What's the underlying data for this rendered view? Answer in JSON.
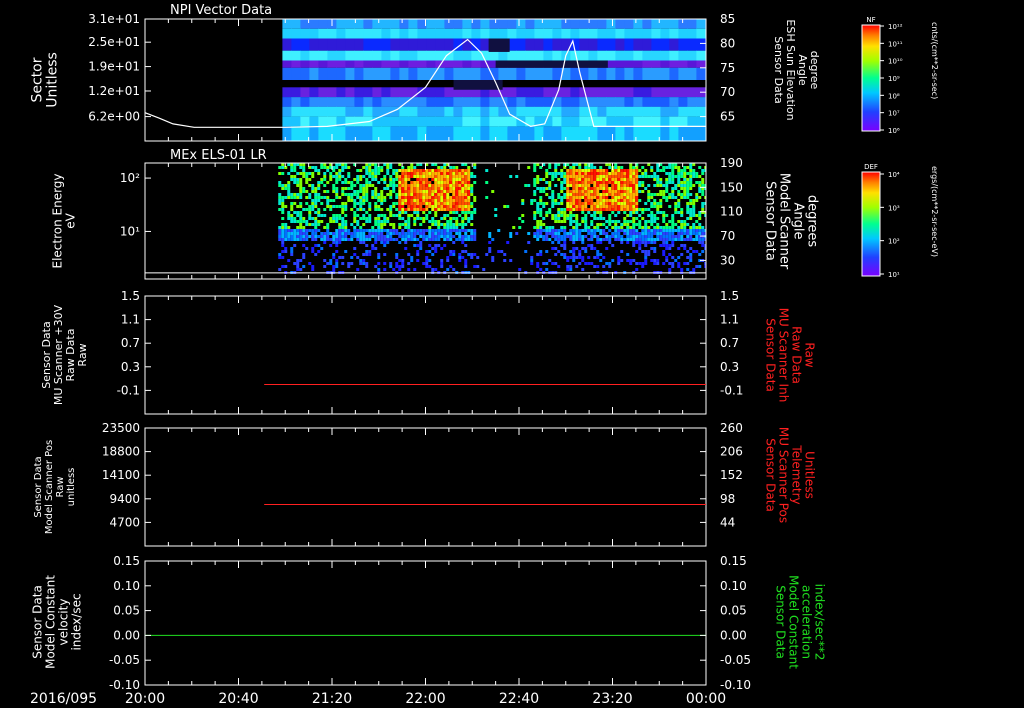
{
  "colors": {
    "background": "#000000",
    "axis": "#ffffff",
    "red_trace": "#ff2020",
    "green_trace": "#20e020",
    "white_trace": "#ffffff"
  },
  "time_axis": {
    "date_label": "2016/095",
    "ticks": [
      "20:00",
      "20:40",
      "21:20",
      "22:00",
      "22:40",
      "23:20",
      "00:00"
    ],
    "range_hours": [
      20.0,
      24.0
    ]
  },
  "chart_data": [
    {
      "type": "heatmap",
      "title": "NPI Vector Data",
      "ylabel_left": [
        "Sector",
        "Unitless"
      ],
      "yticks_left": [
        "3.1e+01",
        "2.5e+01",
        "1.9e+01",
        "1.2e+01",
        "6.2e+00"
      ],
      "ylabel_right": [
        "Sensor Data",
        "ESH Sun Elevation",
        "Angle",
        "degree"
      ],
      "yticks_right": [
        "85",
        "80",
        "75",
        "70",
        "65"
      ],
      "ylim_right": [
        60,
        85
      ],
      "colorbar": {
        "label": "NF",
        "units": "cnts/(cm**2-sr-sec)",
        "ticks": [
          "10¹²",
          "10¹¹",
          "10¹⁰",
          "10⁹",
          "10⁸",
          "10⁷",
          "10⁶"
        ]
      },
      "data_start_hour": 20.98,
      "overlay_line": {
        "name": "ESH Sun Elevation Angle",
        "x": [
          20.0,
          20.1,
          20.2,
          20.35,
          20.6,
          21.0,
          21.3,
          21.6,
          21.8,
          22.0,
          22.15,
          22.3,
          22.4,
          22.5,
          22.6,
          22.75,
          22.85,
          22.95,
          23.0,
          23.05,
          23.1,
          23.2,
          23.5,
          24.0
        ],
        "y": [
          65.8,
          64.7,
          63.5,
          62.8,
          62.8,
          62.8,
          63.0,
          64.0,
          66.5,
          71.0,
          77.5,
          80.8,
          78.0,
          72.0,
          65.5,
          63.0,
          63.5,
          70.5,
          77.5,
          80.5,
          74.0,
          63.0,
          63.0,
          63.0
        ]
      }
    },
    {
      "type": "heatmap",
      "title": "MEx ELS-01 LR",
      "ylabel_left": [
        "Electron Energy",
        "eV"
      ],
      "yticks_left": [
        "10²",
        "10¹"
      ],
      "ylabel_right": [
        "Sensor Data",
        "Model Scanner",
        "Angle",
        "degrees"
      ],
      "yticks_right": [
        "190",
        "150",
        "110",
        "70",
        "30"
      ],
      "ylim_right": [
        0,
        190
      ],
      "colorbar": {
        "label": "DEF",
        "units": "ergs/(cm**2-sr-sec-eV)",
        "ticks": [
          "10⁴",
          "10³",
          "10²",
          "10¹"
        ]
      },
      "data_start_hour": 20.95,
      "overlay_line": {
        "name": "Model Scanner Angle",
        "x": [
          20.0,
          24.0
        ],
        "y": [
          10,
          10
        ]
      }
    },
    {
      "type": "line",
      "ylabel_left": [
        "Sensor Data",
        "MU Scanner +30V",
        "Raw Data",
        "Raw"
      ],
      "yticks_left": [
        "1.5",
        "1.1",
        "0.7",
        "0.3",
        "-0.1"
      ],
      "ylim": [
        -0.5,
        1.5
      ],
      "ylabel_right": [
        "Sensor Data",
        "MU Scanner Inh",
        "Raw Data",
        "Raw"
      ],
      "yticks_right": [
        "1.5",
        "1.1",
        "0.7",
        "0.3",
        "-0.1"
      ],
      "series": [
        {
          "name": "MU Scanner Inh Raw Data",
          "x": [
            20.85,
            24.0
          ],
          "y": [
            0.0,
            0.0
          ]
        }
      ]
    },
    {
      "type": "line",
      "ylabel_left": [
        "Sensor Data",
        "Model Scanner Pos",
        "Raw",
        "unitless"
      ],
      "yticks_left": [
        "23500",
        "18800",
        "14100",
        "9400",
        "4700"
      ],
      "ylim": [
        0,
        23500
      ],
      "ylabel_right": [
        "Sensor Data",
        "MU Scanner Pos",
        "Telemetry",
        "Unitless"
      ],
      "yticks_right": [
        "260",
        "206",
        "152",
        "98",
        "44"
      ],
      "ylim_right": [
        -10,
        260
      ],
      "series": [
        {
          "name": "MU Scanner Pos Telemetry",
          "x": [
            20.85,
            24.0
          ],
          "y": [
            85,
            85
          ]
        }
      ]
    },
    {
      "type": "line",
      "ylabel_left": [
        "Sensor Data",
        "Model Constant",
        "velocity",
        "index/sec"
      ],
      "yticks_left": [
        "0.15",
        "0.10",
        "0.05",
        "0.00",
        "-0.05",
        "-0.10"
      ],
      "ylim": [
        -0.1,
        0.15
      ],
      "ylabel_right": [
        "Sensor Data",
        "Model Constant",
        "acceleration",
        "index/sec**2"
      ],
      "yticks_right": [
        "0.15",
        "0.10",
        "0.05",
        "0.00",
        "-0.05",
        "-0.10"
      ],
      "series": [
        {
          "name": "Model Constant acceleration",
          "x": [
            20.0,
            24.0
          ],
          "y": [
            0.0,
            0.0
          ]
        }
      ]
    }
  ]
}
